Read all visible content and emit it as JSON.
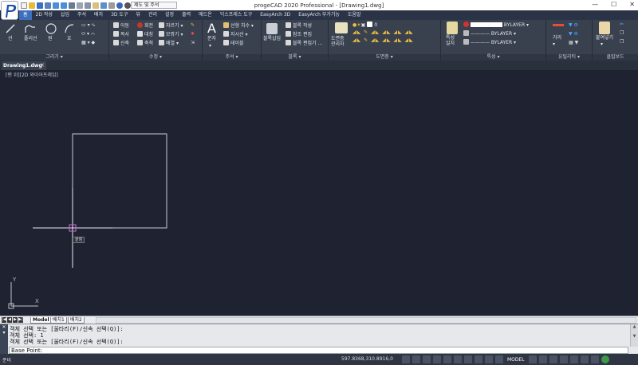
{
  "title": {
    "text": "progeCAD 2020 Professional - [Drawing1.dwg]"
  },
  "qat": {
    "workspace": "제도 및 주석"
  },
  "window_controls": {
    "minimize": "—",
    "maximize": "☐",
    "close": "✕"
  },
  "tabs": [
    "홈",
    "2D 작성",
    "삽입",
    "주석",
    "배치",
    "3D 도구",
    "뷰",
    "관리",
    "설정",
    "출력",
    "애드온",
    "익스프레스 도구",
    "EasyArch 3D",
    "EasyArch 부가기능",
    "도움말"
  ],
  "active_tab": "홈",
  "ribbon": {
    "draw": {
      "title": "그리기 ▾",
      "line": "선",
      "polyline": "폴리선",
      "circle": "원",
      "arc": "호"
    },
    "modify": {
      "title": "수정 ▾",
      "move": "이동",
      "rotate": "회전",
      "trim": "자르기",
      "copy": "복사",
      "mirror": "대칭",
      "fillet": "모깎기",
      "stretch": "신축",
      "scale": "축척",
      "array": "배열"
    },
    "annotation": {
      "title": "주석 ▾",
      "text": "문자",
      "dim": "선형 치수",
      "leader": "지시선",
      "table": "테이블"
    },
    "block": {
      "title": "블록 ▾",
      "insert": "블록삽입",
      "create": "블록 작성",
      "ref_edit": "참조 편집",
      "block_edit": "블록 편집기 ..."
    },
    "layers": {
      "title": "도면층 ▾",
      "manager": "도면층\n관리자",
      "current_layer": "0"
    },
    "properties": {
      "title": "특성 ▾",
      "match": "특성\n일치",
      "color": "BYLAYER",
      "linetype": "BYLAYER",
      "lineweight": "BYLAYER"
    },
    "utilities": {
      "title": "유틸리티 ▾",
      "measure": "거리"
    },
    "clipboard": {
      "title": "클립보드",
      "paste": "붙여넣기"
    }
  },
  "doc_tab": {
    "name": "Drawing1.dwg",
    "close": "✕"
  },
  "viewport_label": "[맨 위][2D 와이어프레임]",
  "crosshair_tooltip": "끝점",
  "ucs": {
    "x": "X",
    "y": "Y"
  },
  "layout_tabs": [
    "Model",
    "배치1",
    "배치2"
  ],
  "command_lines": [
    "객체 선택 또는 [울타리(F)/신속 선택(Q)]:",
    "객체 선택: 1",
    "객체 선택 또는 [울타리(F)/신속 선택(Q)]:"
  ],
  "command_prompt": "Base Point:",
  "status": {
    "left": "준비",
    "coords": "597.8368,310.8916,0",
    "model": "MODEL"
  }
}
